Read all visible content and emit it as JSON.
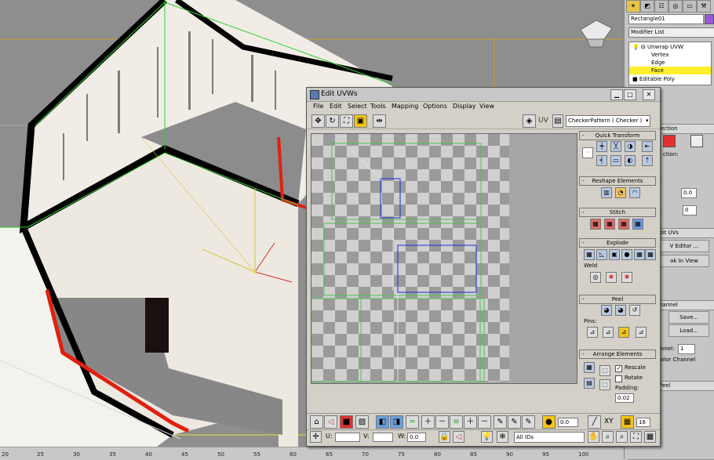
{
  "dialog": {
    "title": "Edit UVWs",
    "menu": [
      "File",
      "Edit",
      "Select",
      "Tools",
      "Mapping",
      "Options",
      "Display",
      "View"
    ],
    "toolbar": {
      "uv_label": "UV",
      "texture_dropdown": "CheckerPattern  ( Checker )"
    },
    "panels": {
      "quick_transform": "Quick Transform",
      "reshape": "Reshape Elements",
      "stitch": "Stitch",
      "explode": "Explode",
      "weld": "Weld",
      "peel": "Peel",
      "pins": "Pins:",
      "arrange": "Arrange Elements",
      "rescale": "Rescale",
      "rotate": "Rotate",
      "padding_label": "Padding:",
      "padding_value": "0.02",
      "collapse_glyph": "-"
    },
    "bottom": {
      "angle_value": "0.0",
      "xy_label": "XY",
      "grid_value": "16",
      "u_label": "U:",
      "v_label": "V:",
      "w_label": "W:",
      "w_value": "0.0",
      "ids_dropdown": "All IDs"
    }
  },
  "command_panel": {
    "object_name": "Rectangle01",
    "modifier_list": "Modifier List",
    "stack": [
      {
        "label": "Unwrap UVW",
        "indent": 0
      },
      {
        "label": "Vertex",
        "indent": 2
      },
      {
        "label": "Edge",
        "indent": 2
      },
      {
        "label": "Face",
        "indent": 2
      },
      {
        "label": "Editable Poly",
        "indent": 0
      }
    ],
    "selected_stack_item": "Face",
    "labels": {
      "selection": "lection",
      "selection_sub": "ction:",
      "edit_uvs": "dit UVs",
      "uv_editor": "V Editor ...",
      "break_in_view": "ak In View",
      "channel": "hannel",
      "save": "Save...",
      "load": "Load...",
      "channel_num_label": "nnel:",
      "channel_num_value": "1",
      "color_channel": "olor Channel",
      "peel": "Peel",
      "spin1": "0.0",
      "spin2": "0"
    }
  },
  "ruler": {
    "ticks": [
      "20",
      "25",
      "30",
      "35",
      "40",
      "45",
      "50",
      "55",
      "60",
      "65",
      "70",
      "75",
      "80",
      "85",
      "90",
      "95",
      "100"
    ]
  },
  "colors": {
    "accent": "#ffef2e",
    "selection": "#f5c518",
    "uv_shell": "#4ec24e",
    "uv_select": "#1a2fd6"
  }
}
